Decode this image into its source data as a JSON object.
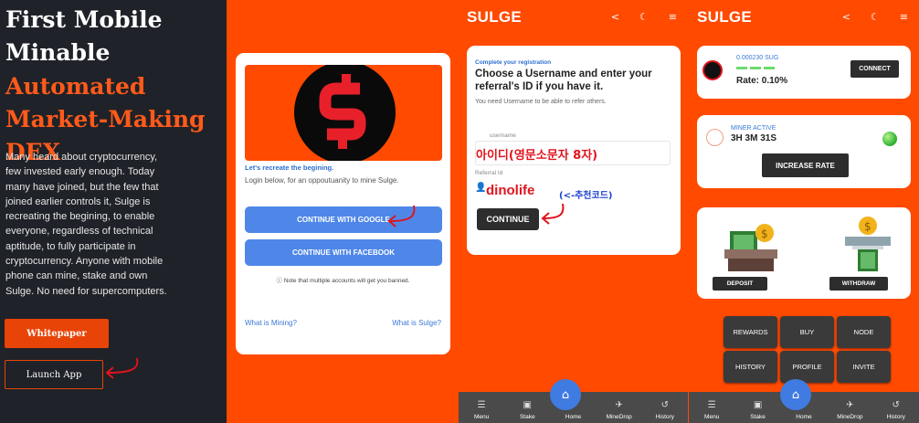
{
  "landing": {
    "title": "First Mobile Minable",
    "subtitle": "Automated Market-Making DEX",
    "description": "Many heard about cryptocurrency, few invested early enough. Today many have joined, but the few that joined earlier controls it, Sulge is recreating the begining, to enable everyone, regardless of technical aptitude, to fully participate in cryptocurrency. Anyone with mobile phone can mine, stake and own Sulge. No need for supercomputers.",
    "whitepaper_label": "Whitepaper",
    "launch_label": "Launch App"
  },
  "login": {
    "title": "Let's recreate the begining.",
    "subtitle": "Login below, for an oppoutuanity to mine Sulge.",
    "google_label": "CONTINUE WITH GOOGLE",
    "facebook_label": "CONTINUE WITH FACEBOOK",
    "note": "Note that multiple accounts will get you banned.",
    "link_mining": "What is Mining?",
    "link_sulge": "What is Sulge?"
  },
  "app": {
    "brand": "SULGE",
    "icons": [
      "share-icon",
      "moon-icon",
      "menu-icon"
    ],
    "nav": [
      {
        "label": "Menu",
        "icon": "menu-icon"
      },
      {
        "label": "Stake",
        "icon": "wallet-icon"
      },
      {
        "label": "Home",
        "icon": "home-icon"
      },
      {
        "label": "MineDrop",
        "icon": "plane-icon"
      },
      {
        "label": "History",
        "icon": "history-icon"
      }
    ]
  },
  "registration": {
    "small": "Complete your registration",
    "title": "Choose a Username and enter your referral's ID if you have it.",
    "sub": "You need Username to be able to refer others.",
    "username_label": "username",
    "username_annotation": "아이디(영문소문자 8자)",
    "referral_label": "Referral Id",
    "referral_value": "dinolife",
    "referral_hint": "(<-추천코드)",
    "continue_label": "CONTINUE"
  },
  "dashboard": {
    "amount": "0.000230 SUG",
    "rate": "Rate: 0.10%",
    "connect_label": "CONNECT",
    "miner_status": "MINER ACTIVE",
    "miner_time": "3H 3M 31S",
    "increase_label": "INCREASE RATE",
    "deposit_label": "DEPOSIT",
    "withdraw_label": "WITHDRAW",
    "grid": [
      "REWARDS",
      "BUY",
      "NODE",
      "HISTORY",
      "PROFILE",
      "INVITE"
    ]
  },
  "colors": {
    "accent": "#ff4a00",
    "dark": "#1f2228",
    "blue": "#4f87e8",
    "annotation_red": "#e0141e"
  }
}
